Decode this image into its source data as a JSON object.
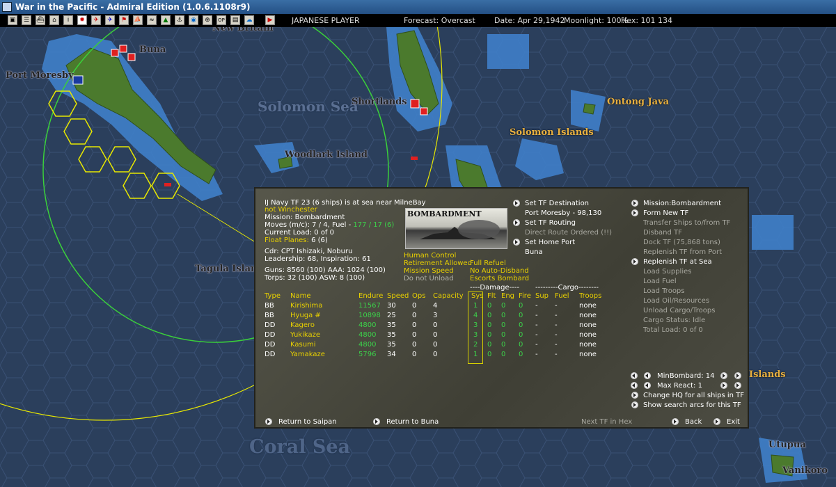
{
  "window": {
    "title": "War in the Pacific - Admiral Edition (1.0.6.1108r9)"
  },
  "topbar": {
    "player": "JAPANESE PLAYER",
    "forecast": "Forecast: Overcast",
    "date": "Date: Apr 29,1942",
    "moonlight": "Moonlight: 100%",
    "hex": "Hex: 101 134"
  },
  "toolbar_icons": [
    "map-icon",
    "list-icon",
    "ships-icon",
    "bases-icon",
    "info-icon",
    "rising-sun-icon",
    "plane-icon",
    "aircraft-icon",
    "flag-icon",
    "ship-icon",
    "routes-icon",
    "terrain-icon",
    "tf-icon",
    "globe-icon",
    "recon-icon",
    "sw-icon",
    "report-icon",
    "weather-icon",
    "end-turn-icon"
  ],
  "map": {
    "labels": {
      "new_britain": "New Britain",
      "buna": "Buna",
      "port_moresby": "Port Moresby",
      "solomon_sea": "Solomon Sea",
      "shortlands": "Shortlands",
      "ontong_java": "Ontong Java",
      "solomon_islands": "Solomon Islands",
      "woodlark": "Woodlark Island",
      "tagula": "Tagula Island",
      "islands": "Islands",
      "coral_sea": "Coral Sea",
      "utupua": "Utupua",
      "vanikoro": "Vanikoro"
    },
    "colors": {
      "sea": "#2b3f5c",
      "shallow": "#3d7ec8",
      "land": "#4a7a2e",
      "range_green": "#3ad03a",
      "range_yellow": "#e8e800",
      "hex_highlight": "#e8e800"
    }
  },
  "tf": {
    "header": "IJ Navy TF 23 (6 ships) is at sea near MilneBay",
    "not_winchester": "not Winchester",
    "mission": "Mission: Bombardment",
    "moves_label": "Moves (m/c): 7 / 4, Fuel - ",
    "moves_fuel": "177 / 17 (6)",
    "current_load": "Current Load:  0 of 0",
    "float_planes_label": "Float Planes:",
    "float_planes_value": " 6 (6)",
    "cdr": "Cdr: CPT  Ishizaki, Noburu",
    "leadership": "Leadership: 68, Inspiration: 61",
    "guns": "Guns: 8560 (100)  AAA: 1024 (100)",
    "torps": "Torps: 32 (100)     ASW: 8 (100)",
    "mission_image_caption": "BOMBARDMENT",
    "options_left": [
      "Human Control",
      "Retirement Allowed",
      "Mission Speed",
      "Do not Unload"
    ],
    "options_right": [
      "Full Refuel",
      "No Auto-Disband",
      "Escorts Bombard"
    ],
    "destination": {
      "set_dest": "Set TF Destination",
      "dest_value": "Port Moresby - 98,130",
      "set_routing": "Set TF Routing",
      "direct_route": "Direct Route Ordered (!!)",
      "set_home": "Set Home Port",
      "home_value": "Buna"
    },
    "table": {
      "damage_header": "----Damage----",
      "cargo_header": "---------Cargo--------",
      "columns": [
        "Type",
        "Name",
        "Endure",
        "Speed",
        "Ops",
        "Capacity",
        "Sys",
        "Flt",
        "Eng",
        "Fire",
        "Sup",
        "Fuel",
        "Troops"
      ],
      "rows": [
        [
          "BB",
          "Kirishima",
          "11567",
          "30",
          "0",
          "4",
          "1",
          "0",
          "0",
          "0",
          "-",
          "-",
          "none"
        ],
        [
          "BB",
          "Hyuga #",
          "10898",
          "25",
          "0",
          "3",
          "4",
          "0",
          "0",
          "0",
          "-",
          "-",
          "none"
        ],
        [
          "DD",
          "Kagero",
          "4800",
          "35",
          "0",
          "0",
          "3",
          "0",
          "0",
          "0",
          "-",
          "-",
          "none"
        ],
        [
          "DD",
          "Yukikaze",
          "4800",
          "35",
          "0",
          "0",
          "3",
          "0",
          "0",
          "0",
          "-",
          "-",
          "none"
        ],
        [
          "DD",
          "Kasumi",
          "4800",
          "35",
          "0",
          "0",
          "2",
          "0",
          "0",
          "0",
          "-",
          "-",
          "none"
        ],
        [
          "DD",
          "Yamakaze",
          "5796",
          "34",
          "0",
          "0",
          "1",
          "0",
          "0",
          "0",
          "-",
          "-",
          "none"
        ]
      ]
    },
    "right_menu": {
      "mission": "Mission:Bombardment",
      "form_new": "Form New TF",
      "transfer": "Transfer Ships to/from TF",
      "disband": "Disband TF",
      "dock": "Dock TF (75,868 tons)",
      "replenish_port": "Replenish TF from Port",
      "replenish_sea": "Replenish TF at Sea",
      "load_supplies": "Load Supplies",
      "load_fuel": "Load Fuel",
      "load_troops": "Load Troops",
      "load_oil": "Load Oil/Resources",
      "unload": "Unload Cargo/Troops",
      "cargo_status": "Cargo Status: Idle",
      "total_load": "Total Load: 0 of 0"
    },
    "controls": {
      "min_bombard": "MinBombard: 14",
      "max_react": "Max React:  1",
      "change_hq": "Change HQ for all ships in TF",
      "show_search": "Show search arcs for this TF"
    },
    "footer": {
      "return_saipan": "Return to Saipan",
      "return_buna": "Return to Buna",
      "next_tf": "Next TF in Hex",
      "back": "Back",
      "exit": "Exit"
    }
  }
}
